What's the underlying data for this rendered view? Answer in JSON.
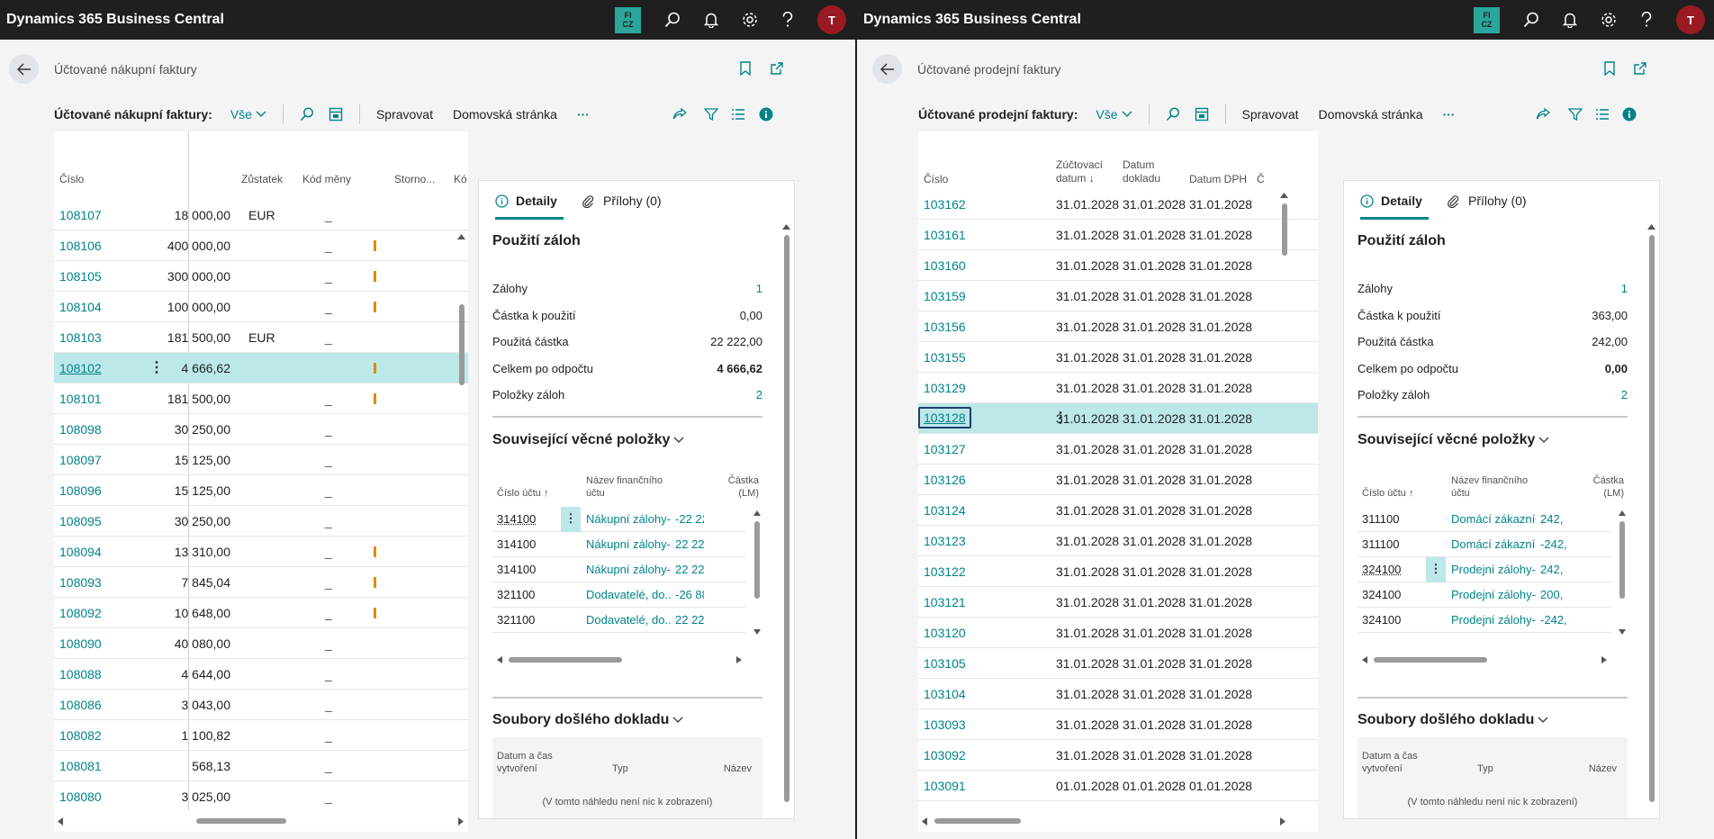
{
  "app_title": "Dynamics 365 Business Central",
  "topbar": {
    "company_badge_line1": "FI",
    "company_badge_line2": "CZ",
    "avatar_initial": "T",
    "icons": [
      "search-icon",
      "bell-icon",
      "gear-icon",
      "help-icon"
    ]
  },
  "left": {
    "page_title": "Účtované nákupní faktury",
    "filter_label": "Účtované nákupní faktury:",
    "filter_value": "Vše",
    "actions": {
      "manage": "Spravovat",
      "home": "Domovská stránka",
      "more": "···"
    },
    "columns": {
      "number": "Číslo",
      "balance": "Zůstatek",
      "currency": "Kód měny",
      "storno": "Storno...",
      "cut": "Kó"
    },
    "rows": [
      {
        "number": "108107",
        "balance": "18 000,00",
        "currency": "EUR",
        "storno": "_",
        "flag": false
      },
      {
        "number": "108106",
        "balance": "400 000,00",
        "currency": "",
        "storno": "_",
        "flag": true
      },
      {
        "number": "108105",
        "balance": "300 000,00",
        "currency": "",
        "storno": "_",
        "flag": true
      },
      {
        "number": "108104",
        "balance": "100 000,00",
        "currency": "",
        "storno": "_",
        "flag": true
      },
      {
        "number": "108103",
        "balance": "181 500,00",
        "currency": "EUR",
        "storno": "_",
        "flag": false
      },
      {
        "number": "108102",
        "balance": "4 666,62",
        "currency": "",
        "storno": "",
        "flag": true,
        "selected": true
      },
      {
        "number": "108101",
        "balance": "181 500,00",
        "currency": "",
        "storno": "_",
        "flag": true
      },
      {
        "number": "108098",
        "balance": "30 250,00",
        "currency": "",
        "storno": "_",
        "flag": false
      },
      {
        "number": "108097",
        "balance": "15 125,00",
        "currency": "",
        "storno": "_",
        "flag": false
      },
      {
        "number": "108096",
        "balance": "15 125,00",
        "currency": "",
        "storno": "_",
        "flag": false
      },
      {
        "number": "108095",
        "balance": "30 250,00",
        "currency": "",
        "storno": "_",
        "flag": false
      },
      {
        "number": "108094",
        "balance": "13 310,00",
        "currency": "",
        "storno": "_",
        "flag": true
      },
      {
        "number": "108093",
        "balance": "7 845,04",
        "currency": "",
        "storno": "_",
        "flag": true
      },
      {
        "number": "108092",
        "balance": "10 648,00",
        "currency": "",
        "storno": "_",
        "flag": true
      },
      {
        "number": "108090",
        "balance": "40 080,00",
        "currency": "",
        "storno": "_",
        "flag": false
      },
      {
        "number": "108088",
        "balance": "4 644,00",
        "currency": "",
        "storno": "_",
        "flag": false
      },
      {
        "number": "108086",
        "balance": "3 043,00",
        "currency": "",
        "storno": "_",
        "flag": false
      },
      {
        "number": "108082",
        "balance": "1 100,82",
        "currency": "",
        "storno": "_",
        "flag": false
      },
      {
        "number": "108081",
        "balance": "568,13",
        "currency": "",
        "storno": "_",
        "flag": false
      },
      {
        "number": "108080",
        "balance": "3 025,00",
        "currency": "",
        "storno": "_",
        "flag": false
      }
    ],
    "factbox": {
      "tab_details": "Detaily",
      "tab_attachments": "Přílohy (0)",
      "section_title": "Použití záloh",
      "items": [
        {
          "label": "Zálohy",
          "value": "1",
          "link": true,
          "bold": false
        },
        {
          "label": "Částka k použití",
          "value": "0,00",
          "link": false,
          "bold": false
        },
        {
          "label": "Použitá částka",
          "value": "22 222,00",
          "link": false,
          "bold": false
        },
        {
          "label": "Celkem po odpočtu",
          "value": "4 666,62",
          "link": false,
          "bold": true
        },
        {
          "label": "Položky záloh",
          "value": "2",
          "link": true,
          "bold": false
        }
      ],
      "gl_title": "Související věcné položky",
      "gl_cols": {
        "account_no": "Číslo účtu ↑",
        "name_1": "Název finančního",
        "name_2": "účtu",
        "amount_1": "Částka",
        "amount_2": "(LM)"
      },
      "gl_rows": [
        {
          "account": "314100",
          "name": "Nákupní zálohy-...",
          "amount": "-22 22"
        },
        {
          "account": "314100",
          "name": "Nákupní zálohy-...",
          "amount": "22 22"
        },
        {
          "account": "314100",
          "name": "Nákupní zálohy-...",
          "amount": "22 22"
        },
        {
          "account": "321100",
          "name": "Dodavatelé, do...",
          "amount": "-26 88"
        },
        {
          "account": "321100",
          "name": "Dodavatelé, do...",
          "amount": "22 22"
        }
      ],
      "files_title": "Soubory došlého dokladu",
      "files_cols": {
        "created_1": "Datum a čas",
        "created_2": "vytvoření",
        "type": "Typ",
        "name": "Název"
      },
      "files_empty": "(V tomto náhledu není nic k zobrazení)"
    }
  },
  "right": {
    "page_title": "Účtované prodejní faktury",
    "filter_label": "Účtované prodejní faktury:",
    "filter_value": "Vše",
    "actions": {
      "manage": "Spravovat",
      "home": "Domovská stránka",
      "more": "···"
    },
    "columns": {
      "number": "Číslo",
      "posting_1": "Zúčtovací",
      "posting_2": "datum ↓",
      "doc_1": "Datum",
      "doc_2": "dokladu",
      "vat": "Datum DPH",
      "cut": "Č"
    },
    "rows": [
      {
        "number": "103162",
        "posting": "31.01.2028",
        "doc": "31.01.2028",
        "vat": "31.01.2028"
      },
      {
        "number": "103161",
        "posting": "31.01.2028",
        "doc": "31.01.2028",
        "vat": "31.01.2028"
      },
      {
        "number": "103160",
        "posting": "31.01.2028",
        "doc": "31.01.2028",
        "vat": "31.01.2028"
      },
      {
        "number": "103159",
        "posting": "31.01.2028",
        "doc": "31.01.2028",
        "vat": "31.01.2028"
      },
      {
        "number": "103156",
        "posting": "31.01.2028",
        "doc": "31.01.2028",
        "vat": "31.01.2028"
      },
      {
        "number": "103155",
        "posting": "31.01.2028",
        "doc": "31.01.2028",
        "vat": "31.01.2028"
      },
      {
        "number": "103129",
        "posting": "31.01.2028",
        "doc": "31.01.2028",
        "vat": "31.01.2028"
      },
      {
        "number": "103128",
        "posting": "31.01.2028",
        "doc": "31.01.2028",
        "vat": "31.01.2028",
        "selected": true
      },
      {
        "number": "103127",
        "posting": "31.01.2028",
        "doc": "31.01.2028",
        "vat": "31.01.2028"
      },
      {
        "number": "103126",
        "posting": "31.01.2028",
        "doc": "31.01.2028",
        "vat": "31.01.2028"
      },
      {
        "number": "103124",
        "posting": "31.01.2028",
        "doc": "31.01.2028",
        "vat": "31.01.2028"
      },
      {
        "number": "103123",
        "posting": "31.01.2028",
        "doc": "31.01.2028",
        "vat": "31.01.2028"
      },
      {
        "number": "103122",
        "posting": "31.01.2028",
        "doc": "31.01.2028",
        "vat": "31.01.2028"
      },
      {
        "number": "103121",
        "posting": "31.01.2028",
        "doc": "31.01.2028",
        "vat": "31.01.2028"
      },
      {
        "number": "103120",
        "posting": "31.01.2028",
        "doc": "31.01.2028",
        "vat": "31.01.2028"
      },
      {
        "number": "103105",
        "posting": "31.01.2028",
        "doc": "31.01.2028",
        "vat": "31.01.2028"
      },
      {
        "number": "103104",
        "posting": "31.01.2028",
        "doc": "31.01.2028",
        "vat": "31.01.2028"
      },
      {
        "number": "103093",
        "posting": "31.01.2028",
        "doc": "31.01.2028",
        "vat": "31.01.2028"
      },
      {
        "number": "103092",
        "posting": "31.01.2028",
        "doc": "31.01.2028",
        "vat": "31.01.2028"
      },
      {
        "number": "103091",
        "posting": "01.01.2028",
        "doc": "01.01.2028",
        "vat": "01.01.2028"
      }
    ],
    "factbox": {
      "tab_details": "Detaily",
      "tab_attachments": "Přílohy (0)",
      "section_title": "Použití záloh",
      "items": [
        {
          "label": "Zálohy",
          "value": "1",
          "link": true,
          "bold": false
        },
        {
          "label": "Částka k použití",
          "value": "363,00",
          "link": false,
          "bold": false
        },
        {
          "label": "Použitá částka",
          "value": "242,00",
          "link": false,
          "bold": false
        },
        {
          "label": "Celkem po odpočtu",
          "value": "0,00",
          "link": false,
          "bold": true
        },
        {
          "label": "Položky záloh",
          "value": "2",
          "link": true,
          "bold": false
        }
      ],
      "gl_title": "Související věcné položky",
      "gl_cols": {
        "account_no": "Číslo účtu ↑",
        "name_1": "Název finančního",
        "name_2": "účtu",
        "amount_1": "Částka",
        "amount_2": "(LM)"
      },
      "gl_rows": [
        {
          "account": "311100",
          "name": "Domácí zákazníc...",
          "amount": "242,"
        },
        {
          "account": "311100",
          "name": "Domácí zákazníc...",
          "amount": "-242,"
        },
        {
          "account": "324100",
          "name": "Prodejní zálohy-...",
          "amount": "242,"
        },
        {
          "account": "324100",
          "name": "Prodejní zálohy-...",
          "amount": "200,"
        },
        {
          "account": "324100",
          "name": "Prodejní zálohy-...",
          "amount": "-242,"
        }
      ],
      "files_title": "Soubory došlého dokladu",
      "files_cols": {
        "created_1": "Datum a čas",
        "created_2": "vytvoření",
        "type": "Typ",
        "name": "Název"
      },
      "files_empty": "(V tomto náhledu není nic k zobrazení)"
    }
  },
  "colors": {
    "accent": "#008489",
    "topbar": "#1f1f1f",
    "selected_row": "#bde8ea",
    "avatar": "#9a1a24",
    "badge": "#2aa69b",
    "flag": "#e08a00"
  }
}
